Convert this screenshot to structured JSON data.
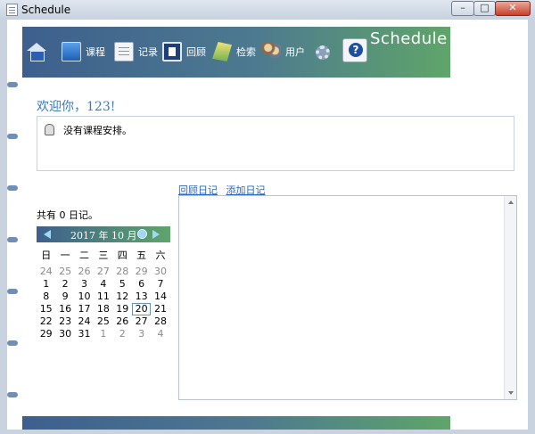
{
  "window": {
    "title": "Schedule"
  },
  "toolbar": {
    "course": "课程",
    "record": "记录",
    "review": "回顾",
    "search": "检索",
    "user": "用户",
    "brand": "Schedule"
  },
  "welcome": "欢迎你，123!",
  "course_panel": {
    "empty_text": "没有课程安排。"
  },
  "diary_links": {
    "review": "回顾日记",
    "add": "添加日记"
  },
  "diary_count": "共有 0 日记。",
  "calendar": {
    "title": "2017 年 10 月",
    "weekdays": [
      "日",
      "一",
      "二",
      "三",
      "四",
      "五",
      "六"
    ],
    "weeks": [
      [
        {
          "d": "24",
          "o": true
        },
        {
          "d": "25",
          "o": true
        },
        {
          "d": "26",
          "o": true
        },
        {
          "d": "27",
          "o": true
        },
        {
          "d": "28",
          "o": true
        },
        {
          "d": "29",
          "o": true
        },
        {
          "d": "30",
          "o": true
        }
      ],
      [
        {
          "d": "1"
        },
        {
          "d": "2"
        },
        {
          "d": "3"
        },
        {
          "d": "4"
        },
        {
          "d": "5"
        },
        {
          "d": "6"
        },
        {
          "d": "7"
        }
      ],
      [
        {
          "d": "8"
        },
        {
          "d": "9"
        },
        {
          "d": "10"
        },
        {
          "d": "11"
        },
        {
          "d": "12"
        },
        {
          "d": "13"
        },
        {
          "d": "14"
        }
      ],
      [
        {
          "d": "15"
        },
        {
          "d": "16"
        },
        {
          "d": "17"
        },
        {
          "d": "18"
        },
        {
          "d": "19"
        },
        {
          "d": "20",
          "t": true
        },
        {
          "d": "21"
        }
      ],
      [
        {
          "d": "22"
        },
        {
          "d": "23"
        },
        {
          "d": "24"
        },
        {
          "d": "25"
        },
        {
          "d": "26"
        },
        {
          "d": "27"
        },
        {
          "d": "28"
        }
      ],
      [
        {
          "d": "29"
        },
        {
          "d": "30"
        },
        {
          "d": "31"
        },
        {
          "d": "1",
          "o": true
        },
        {
          "d": "2",
          "o": true
        },
        {
          "d": "3",
          "o": true
        },
        {
          "d": "4",
          "o": true
        }
      ]
    ]
  },
  "colors": {
    "accent": "#3a78c8",
    "banner_start": "#3d5f8e",
    "banner_end": "#5fa56a"
  }
}
